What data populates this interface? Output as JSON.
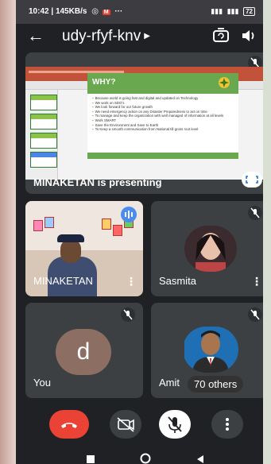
{
  "status_bar": {
    "time": "10:42",
    "speed": "145KB/s",
    "extra": "···",
    "battery": "72"
  },
  "header": {
    "meeting_code": "udy-rfyf-knv"
  },
  "presentation": {
    "label": "MINAKETAN is presenting",
    "slide": {
      "heading": "WHY?",
      "bullets": [
        "Because world is going fast and digital and updated on Technology",
        "We work on SDG's",
        "We look forward for our future growth",
        "We need emergency action on any Disaster Preparedness to act on time",
        "To manage and keep the organization with well managed of information at all levels",
        "Work SMART",
        "Save the Environment and Save to Earth",
        "To Keep a smooth communication from National till gross root level"
      ]
    }
  },
  "participants": [
    {
      "name": "MINAKETAN"
    },
    {
      "name": "Sasmita"
    },
    {
      "name": "You",
      "initial": "d"
    },
    {
      "name": "Amit",
      "overflow_label": "70 others"
    }
  ],
  "colors": {
    "accent": "#ea4335",
    "speaking": "#4a8cf0",
    "slide_green": "#6aa84f"
  },
  "icons": {
    "back": "arrow-back-icon",
    "switch_camera": "switch-camera-icon",
    "speaker": "speaker-icon",
    "end_call": "end-call-icon",
    "camera_off": "camera-off-icon",
    "mic_off": "mic-off-icon",
    "more": "more-vertical-icon"
  }
}
